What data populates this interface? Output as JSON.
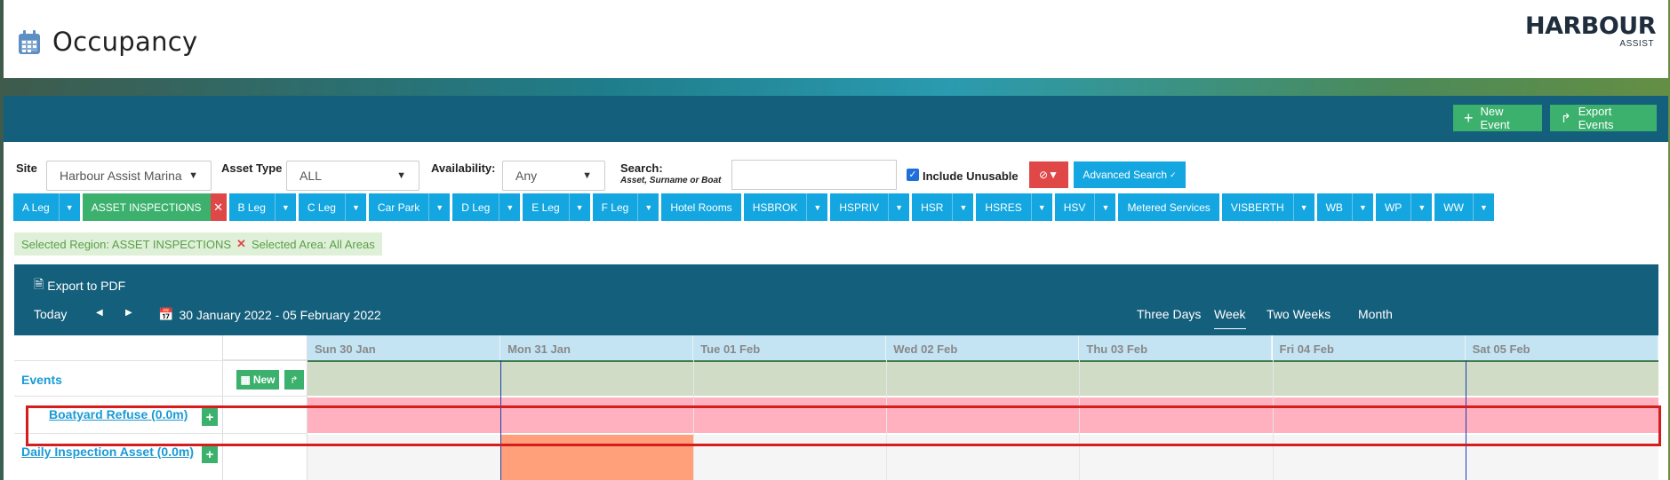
{
  "header": {
    "title": "Occupancy",
    "logo_main": "HARBOUR",
    "logo_sub": "ASSIST"
  },
  "actions": {
    "new_event": "New Event",
    "export_events": "Export Events"
  },
  "filters": {
    "site_label": "Site",
    "site_value": "Harbour Assist Marina",
    "asset_type_label": "Asset Type",
    "asset_type_value": "ALL",
    "availability_label": "Availability:",
    "availability_value": "Any",
    "search_label": "Search:",
    "search_hint": "Asset, Surname or Boat",
    "search_value": "",
    "include_unusable_label": "Include Unusable",
    "include_unusable_checked": true,
    "advanced_search_label": "Advanced Search"
  },
  "region_tabs": [
    {
      "label": "A Leg",
      "state": "dropdown"
    },
    {
      "label": "ASSET INSPECTIONS",
      "state": "active"
    },
    {
      "label": "B Leg",
      "state": "dropdown"
    },
    {
      "label": "C Leg",
      "state": "dropdown"
    },
    {
      "label": "Car Park",
      "state": "dropdown"
    },
    {
      "label": "D Leg",
      "state": "dropdown"
    },
    {
      "label": "E Leg",
      "state": "dropdown"
    },
    {
      "label": "F Leg",
      "state": "dropdown"
    },
    {
      "label": "Hotel Rooms",
      "state": "plain"
    },
    {
      "label": "HSBROK",
      "state": "dropdown"
    },
    {
      "label": "HSPRIV",
      "state": "dropdown"
    },
    {
      "label": "HSR",
      "state": "dropdown"
    },
    {
      "label": "HSRES",
      "state": "dropdown"
    },
    {
      "label": "HSV",
      "state": "dropdown"
    },
    {
      "label": "Metered Services",
      "state": "plain"
    },
    {
      "label": "VISBERTH",
      "state": "dropdown"
    },
    {
      "label": "WB",
      "state": "dropdown"
    },
    {
      "label": "WP",
      "state": "dropdown"
    },
    {
      "label": "WW",
      "state": "dropdown"
    }
  ],
  "selection": {
    "region": "Selected Region: ASSET INSPECTIONS",
    "area": "Selected Area: All Areas"
  },
  "calendar": {
    "export_pdf": "Export to PDF",
    "today": "Today",
    "range": "30 January 2022 - 05 February 2022",
    "views": [
      "Three Days",
      "Week",
      "Two Weeks",
      "Month"
    ],
    "active_view": "Week",
    "days": [
      "Sun 30 Jan",
      "Mon 31 Jan",
      "Tue 01 Feb",
      "Wed 02 Feb",
      "Thu 03 Feb",
      "Fri 04 Feb",
      "Sat 05 Feb"
    ],
    "events_label": "Events",
    "new_label": "New",
    "resources": [
      "Boatyard Refuse (0.0m)",
      "Daily Inspection Asset (0.0m)"
    ]
  },
  "colors": {
    "tab_blue": "#14a6e0",
    "green": "#3cb16d",
    "header_blue": "#145f7c",
    "booked_pink": "#ffb1c0",
    "booked_orange": "#ffa07a",
    "highlight_red": "#d61d1d"
  }
}
